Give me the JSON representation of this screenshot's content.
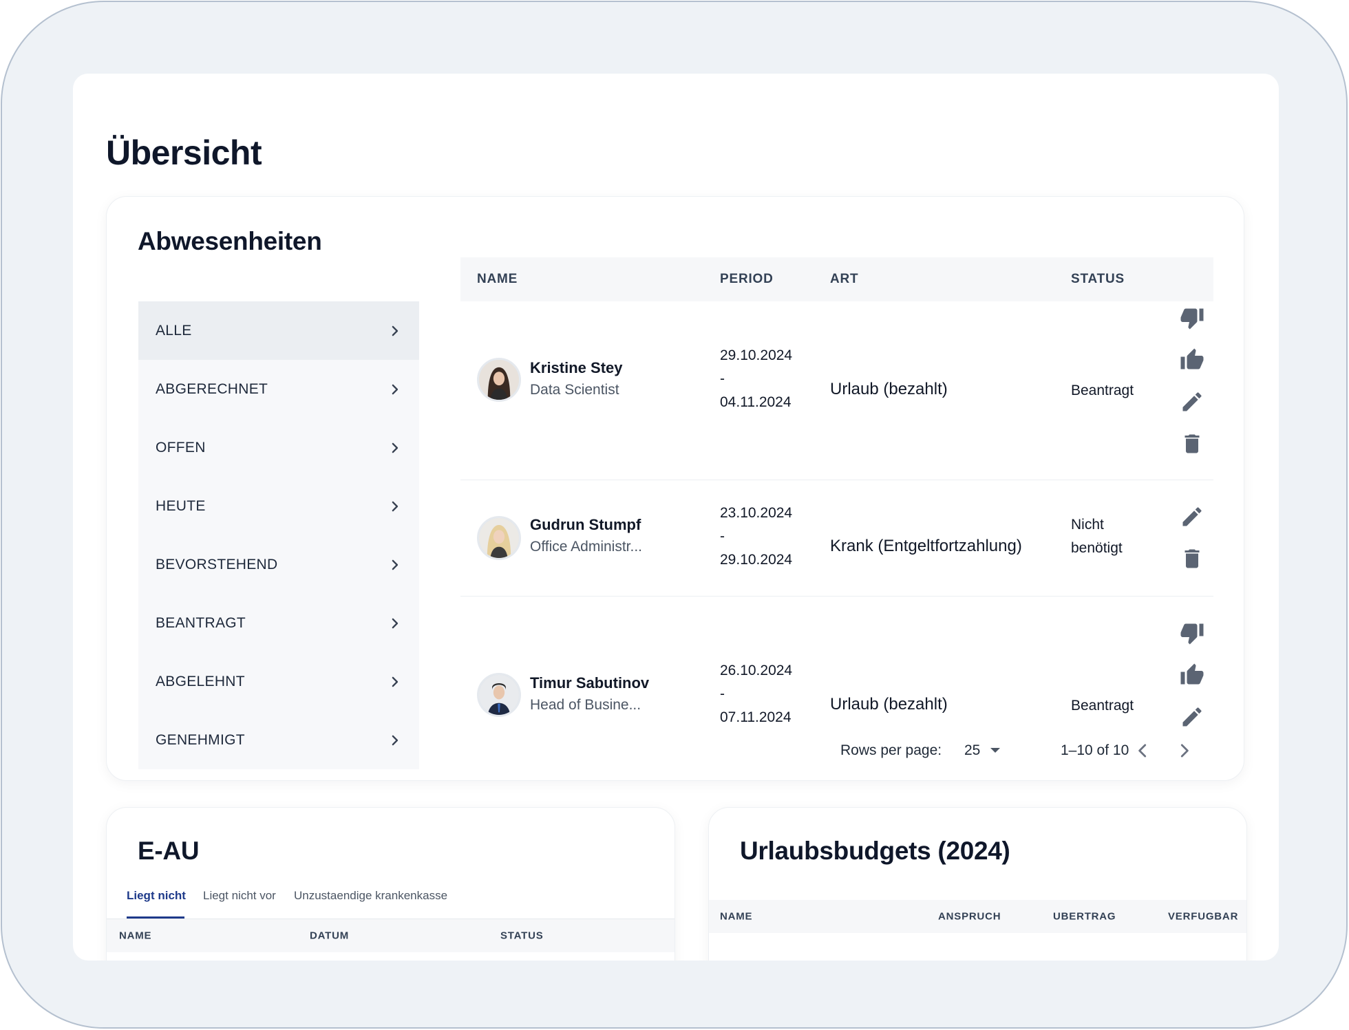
{
  "page": {
    "title": "Übersicht"
  },
  "absences": {
    "title": "Abwesenheiten",
    "filters": [
      {
        "label": "ALLE",
        "active": true
      },
      {
        "label": "ABGERECHNET",
        "active": false
      },
      {
        "label": "OFFEN",
        "active": false
      },
      {
        "label": "HEUTE",
        "active": false
      },
      {
        "label": "BEVORSTEHEND",
        "active": false
      },
      {
        "label": "BEANTRAGT",
        "active": false
      },
      {
        "label": "ABGELEHNT",
        "active": false
      },
      {
        "label": "GENEHMIGT",
        "active": false
      }
    ],
    "columns": {
      "name": "NAME",
      "period": "PERIOD",
      "art": "ART",
      "status": "STATUS"
    },
    "rows": [
      {
        "name": "Kristine Stey",
        "role": "Data Scientist",
        "period_start": "29.10.2024",
        "period_sep": "-",
        "period_end": "04.11.2024",
        "art": "Urlaub (bezahlt)",
        "status": "Beantragt",
        "actions": [
          "thumb-down-icon",
          "thumb-up-icon",
          "edit-icon",
          "delete-icon"
        ]
      },
      {
        "name": "Gudrun Stumpf",
        "role": "Office Administr...",
        "period_start": "23.10.2024",
        "period_sep": "-",
        "period_end": "29.10.2024",
        "art": "Krank (Entgeltfortzahlung)",
        "status_line1": "Nicht",
        "status_line2": "benötigt",
        "actions": [
          "edit-icon",
          "delete-icon"
        ]
      },
      {
        "name": "Timur Sabutinov",
        "role": "Head of Busine...",
        "period_start": "26.10.2024",
        "period_sep": "-",
        "period_end": "07.11.2024",
        "art": "Urlaub (bezahlt)",
        "status": "Beantragt",
        "actions": [
          "thumb-down-icon",
          "thumb-up-icon",
          "edit-icon"
        ]
      }
    ],
    "pagination": {
      "rows_per_page_label": "Rows per page:",
      "rows_per_page": "25",
      "range": "1–10 of 10"
    }
  },
  "eau": {
    "title": "E-AU",
    "tabs": [
      "Liegt nicht",
      "Liegt nicht vor",
      "Unzustaendige krankenkasse"
    ],
    "active_tab": "Liegt nicht",
    "columns": {
      "name": "NAME",
      "datum": "DATUM",
      "status": "STATUS"
    }
  },
  "urlaubsbudgets": {
    "title": "Urlaubsbudgets (2024)",
    "columns": {
      "name": "NAME",
      "anspruch": "ANSPRUCH",
      "uebertrag": "UBERTRAG",
      "verfuegbar": "VERFUGBAR"
    }
  },
  "colors": {
    "accent": "#1e3a8a",
    "icon": "#5b6473",
    "frame": "#eef2f6"
  }
}
